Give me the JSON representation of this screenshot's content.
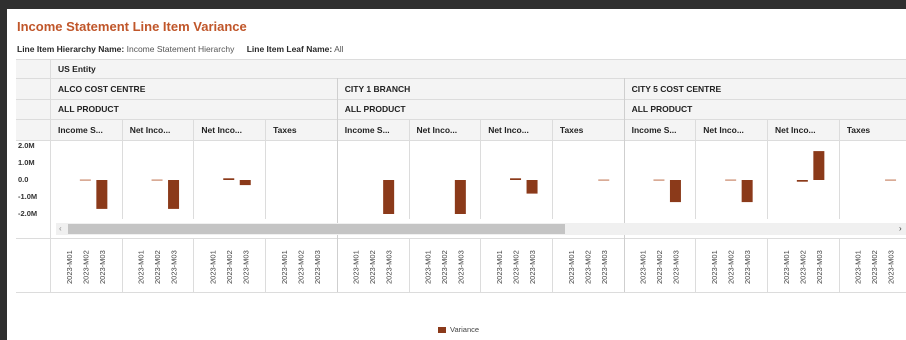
{
  "title": "Income Statement Line Item Variance",
  "filters": {
    "hierarchy_label": "Line Item Hierarchy Name:",
    "hierarchy_value": "Income Statement Hierarchy",
    "leaf_label": "Line Item Leaf Name:",
    "leaf_value": "All"
  },
  "entity": "US Entity",
  "colors": {
    "bar": "#8b3a1a",
    "title": "#c0562a"
  },
  "legend_label": "Variance",
  "chart_data": {
    "type": "bar",
    "title": "Income Statement Line Item Variance",
    "y_ticks": [
      "2.0M",
      "1.0M",
      "0.0",
      "-1.0M",
      "-2.0M"
    ],
    "ylim": [
      -2.2,
      2.2
    ],
    "unit": "M",
    "x_categories": [
      "2023-M01",
      "2023-M02",
      "2023-M03"
    ],
    "series_name": "Variance",
    "groups": [
      {
        "cost_centre": "ALCO COST CENTRE",
        "product": "ALL PRODUCT",
        "panels": [
          {
            "line_item": "Income S...",
            "values": [
              null,
              0.0,
              -1.7
            ]
          },
          {
            "line_item": "Net Inco...",
            "values": [
              null,
              0.0,
              -1.7
            ]
          },
          {
            "line_item": "Net Inco...",
            "values": [
              null,
              0.1,
              -0.3
            ]
          },
          {
            "line_item": "Taxes",
            "values": [
              null,
              null,
              null
            ]
          }
        ]
      },
      {
        "cost_centre": "CITY 1 BRANCH",
        "product": "ALL PRODUCT",
        "panels": [
          {
            "line_item": "Income S...",
            "values": [
              null,
              null,
              -2.0
            ]
          },
          {
            "line_item": "Net Inco...",
            "values": [
              null,
              null,
              -2.0
            ]
          },
          {
            "line_item": "Net Inco...",
            "values": [
              null,
              0.1,
              -0.8
            ]
          },
          {
            "line_item": "Taxes",
            "values": [
              null,
              null,
              0.0
            ]
          }
        ]
      },
      {
        "cost_centre": "CITY 5 COST CENTRE",
        "product": "ALL PRODUCT",
        "panels": [
          {
            "line_item": "Income S...",
            "values": [
              null,
              0.0,
              -1.3
            ]
          },
          {
            "line_item": "Net Inco...",
            "values": [
              null,
              0.0,
              -1.3
            ]
          },
          {
            "line_item": "Net Inco...",
            "values": [
              null,
              -0.1,
              1.7
            ]
          },
          {
            "line_item": "Taxes",
            "values": [
              null,
              null,
              0.0
            ]
          }
        ]
      }
    ]
  }
}
